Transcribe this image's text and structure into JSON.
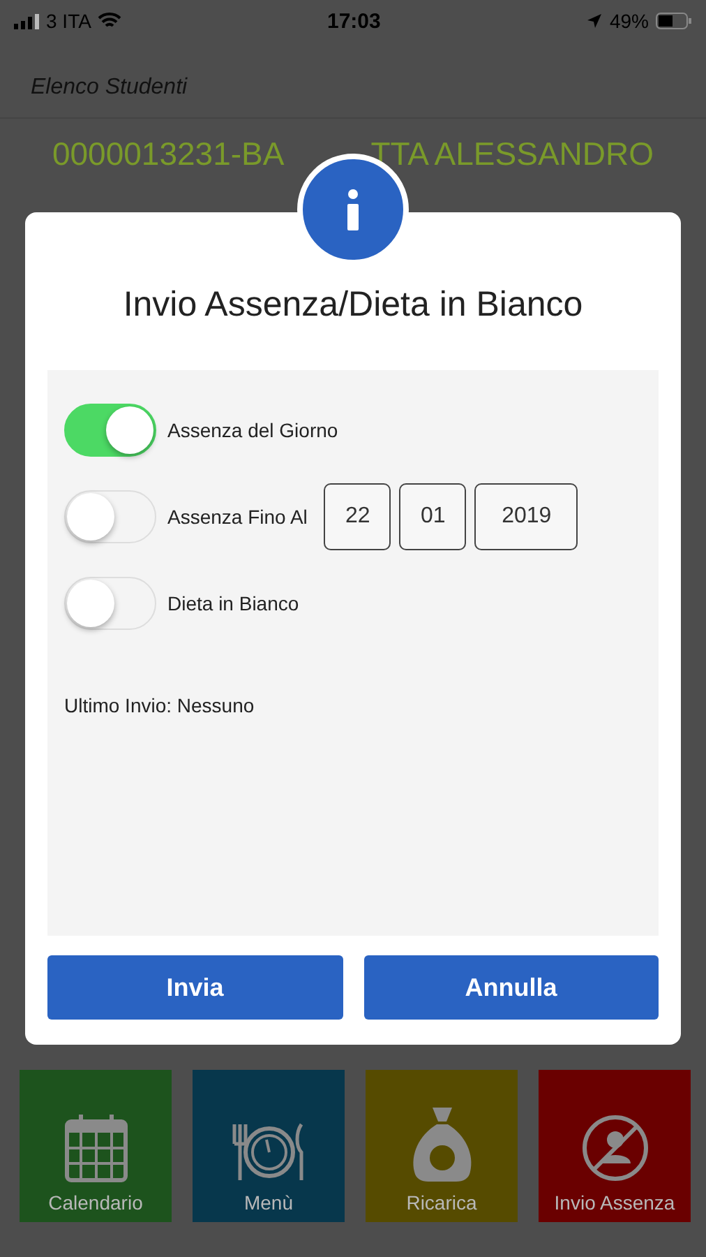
{
  "status_bar": {
    "carrier": "3 ITA",
    "time": "17:03",
    "battery": "49%"
  },
  "header": {
    "title": "Elenco Studenti"
  },
  "student": {
    "name_parts": [
      "0000013231-BA",
      "TTA ALESSANDRO"
    ]
  },
  "dialog": {
    "title": "Invio Assenza/Dieta in Bianco",
    "options": [
      {
        "label": "Assenza del Giorno",
        "on": true
      },
      {
        "label": "Assenza Fino Al",
        "on": false,
        "date": [
          "22",
          "01",
          "2019"
        ]
      },
      {
        "label": "Dieta in Bianco",
        "on": false
      }
    ],
    "last_sent": "Ultimo Invio: Nessuno",
    "buttons": [
      "Invia",
      "Annulla"
    ]
  },
  "tiles": [
    {
      "label": "Calendario",
      "kind": "calendar",
      "color": "#1d531d"
    },
    {
      "label": "Menù",
      "kind": "menu",
      "color": "#07374c"
    },
    {
      "label": "Ricarica",
      "kind": "money",
      "color": "#564b00"
    },
    {
      "label": "Invio Assenza",
      "kind": "absence",
      "color": "#6a0000"
    }
  ]
}
